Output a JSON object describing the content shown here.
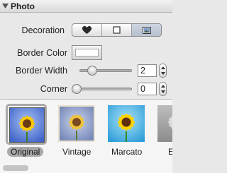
{
  "header": {
    "title": "Photo",
    "expanded": true
  },
  "decoration": {
    "label": "Decoration",
    "segments": [
      {
        "icon": "heart-icon",
        "selected": false
      },
      {
        "icon": "square-frame-icon",
        "selected": false
      },
      {
        "icon": "photo-frame-icon",
        "selected": true
      }
    ]
  },
  "border_color": {
    "label": "Border Color",
    "value": "#ffffff"
  },
  "border_width": {
    "label": "Border Width",
    "value": "2",
    "slider_fraction": 0.2
  },
  "corner": {
    "label": "Corner",
    "value": "0",
    "slider_fraction": 0
  },
  "gallery": {
    "items": [
      {
        "caption": "Original",
        "selected": true
      },
      {
        "caption": "Vintage",
        "selected": false
      },
      {
        "caption": "Marcato",
        "selected": false
      },
      {
        "caption": "E",
        "selected": false
      }
    ]
  },
  "colors": {
    "selected_segment": "#c0c8d6",
    "thumb_sky": "#6f8fd8",
    "petal": "#ffcc00"
  }
}
